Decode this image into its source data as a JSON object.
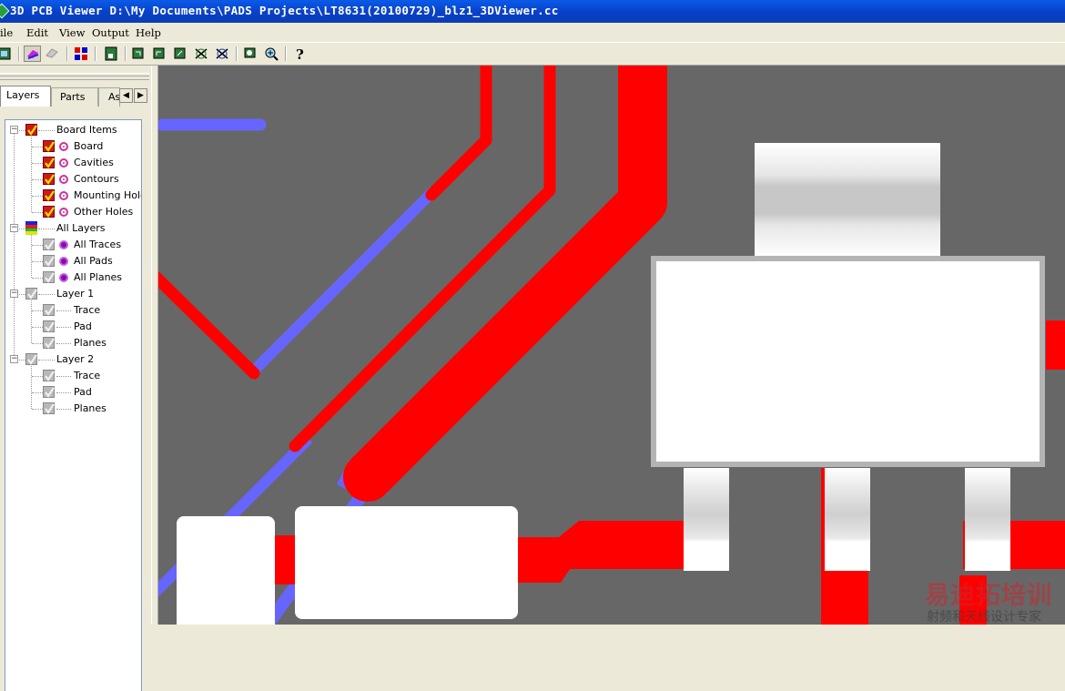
{
  "window": {
    "title": "3D PCB Viewer  D:\\My Documents\\PADS Projects\\LT8631(20100729)_blz1_3DViewer.cc"
  },
  "menu": [
    "ile",
    "Edit",
    "View",
    "Output",
    "Help"
  ],
  "toolbar": {
    "buttons": [
      "cube-view-icon",
      "layers-color-icon",
      "layers-gray-icon",
      "layer-grid-icon",
      "board-icon",
      "view-front-icon",
      "view-back-icon",
      "view-side-icon",
      "rotate-x-icon",
      "rotate-y-icon",
      "zoom-fit-icon",
      "zoom-in-icon",
      "help-icon"
    ]
  },
  "tabs": [
    "Layers",
    "Parts",
    "As"
  ],
  "tree": [
    {
      "label": "Board Items",
      "level": 0,
      "check": "red",
      "icon": "board-items-icon"
    },
    {
      "label": "Board",
      "level": 1,
      "check": "red",
      "icon": "pink"
    },
    {
      "label": "Cavities",
      "level": 1,
      "check": "red",
      "icon": "pink"
    },
    {
      "label": "Contours",
      "level": 1,
      "check": "red",
      "icon": "pink"
    },
    {
      "label": "Mounting Holes",
      "level": 1,
      "check": "red",
      "icon": "pink"
    },
    {
      "label": "Other Holes",
      "level": 1,
      "check": "red",
      "icon": "pink"
    },
    {
      "label": "All Layers",
      "level": 0,
      "check": "layers",
      "icon": "none"
    },
    {
      "label": "All Traces",
      "level": 1,
      "check": "gray",
      "icon": "purple"
    },
    {
      "label": "All Pads",
      "level": 1,
      "check": "gray",
      "icon": "purple"
    },
    {
      "label": "All Planes",
      "level": 1,
      "check": "gray",
      "icon": "purple"
    },
    {
      "label": "Layer 1",
      "level": 0,
      "check": "gray",
      "icon": "none"
    },
    {
      "label": "Trace",
      "level": 1,
      "check": "gray",
      "icon": "line"
    },
    {
      "label": "Pad",
      "level": 1,
      "check": "gray",
      "icon": "line"
    },
    {
      "label": "Planes",
      "level": 1,
      "check": "gray",
      "icon": "line"
    },
    {
      "label": "Layer 2",
      "level": 0,
      "check": "gray",
      "icon": "none"
    },
    {
      "label": "Trace",
      "level": 1,
      "check": "gray",
      "icon": "line"
    },
    {
      "label": "Pad",
      "level": 1,
      "check": "gray",
      "icon": "line"
    },
    {
      "label": "Planes",
      "level": 1,
      "check": "gray",
      "icon": "line"
    }
  ],
  "watermark": {
    "line1": "易迪拓培训",
    "line2": "射频和天线设计专家"
  },
  "colors": {
    "board": "#676767",
    "trace_top": "#ff0000",
    "trace_bottom": "#6666ff",
    "pad": "#ffffff",
    "titlebar": "#0a5be8"
  }
}
